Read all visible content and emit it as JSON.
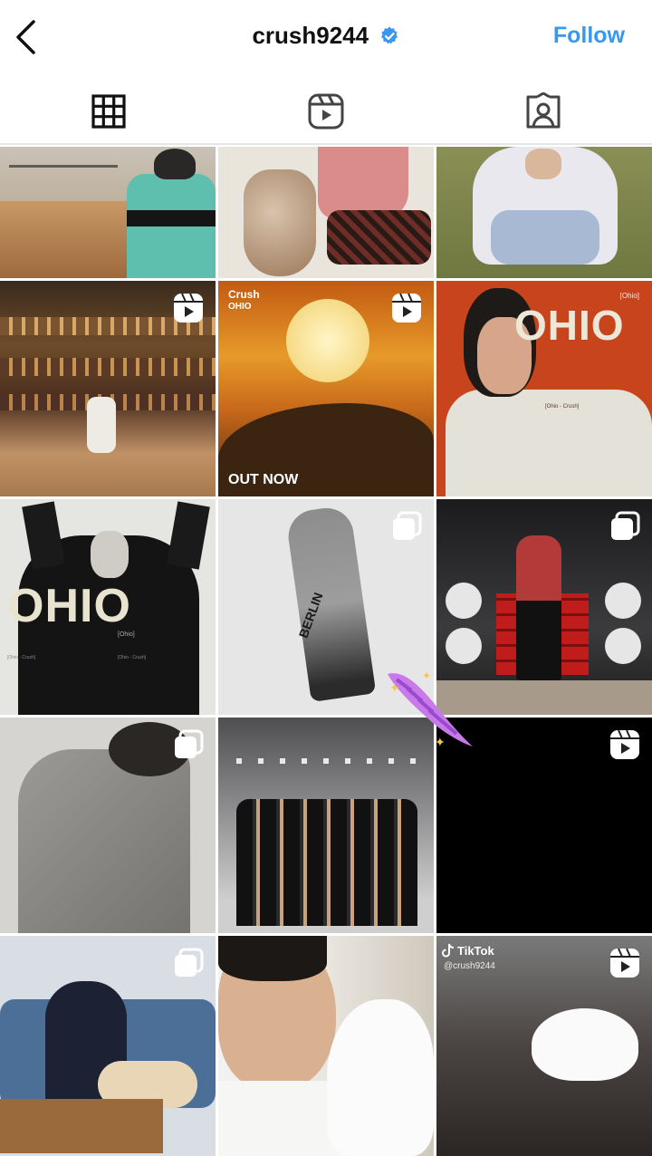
{
  "header": {
    "username": "crush9244",
    "follow_label": "Follow",
    "accent_color": "#3897f0"
  },
  "tabs": [
    {
      "name": "grid-icon",
      "active": true
    },
    {
      "name": "reels-icon",
      "active": false
    },
    {
      "name": "tagged-icon",
      "active": false
    }
  ],
  "posts": {
    "r2c2": {
      "artist": "Crush",
      "album": "OHIO",
      "caption": "OUT NOW"
    },
    "r2c3": {
      "word": "OHIO",
      "sub": "[Ohio]",
      "credit": "[Ohio - Crush]"
    },
    "r3c1": {
      "word": "OHIO",
      "sub": "[Ohio]",
      "credit_left": "[Ohio - Crush]",
      "credit_right": "[Ohio - Crush]"
    },
    "r3c2": {
      "jersey": "BERLIN"
    },
    "r5c3": {
      "brand": "TikTok",
      "handle": "@crush9244"
    }
  }
}
